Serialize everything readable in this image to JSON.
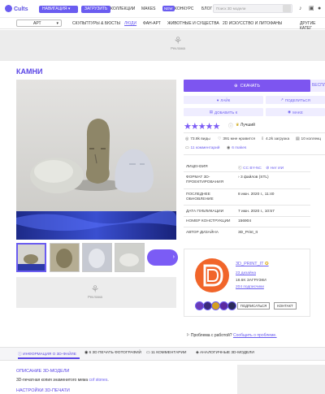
{
  "header": {
    "logo": "Cults",
    "nav_select": "НАВИГАЦИЯ",
    "upload": "ЗАГРУЗИТЬ",
    "links": [
      "КОЛЛЕКЦИИ",
      "MAKES"
    ],
    "new_badge": "NEW",
    "contest": "КОНКУРС",
    "blog": "БЛОГ",
    "search_placeholder": "Поиск 3D модели"
  },
  "subnav": {
    "category": "АРТ",
    "links": [
      "СКУЛЬПТУРЫ & БЮСТЫ",
      "ЛЮДИ",
      "ФАН-АРТ",
      "ЖИВОТНЫЕ И СУЩЕСТВА",
      "2D ИСКУССТВО И ЛИТОФАНЫ"
    ],
    "other": "ДРУГИЕ КАТЕГ"
  },
  "ad_label": "Реклама",
  "title": "КАМНИ",
  "actions": {
    "download": "СКАЧАТЬ",
    "free": "БЕСПЛ",
    "like": "ЛАЙК",
    "share": "ПОДЕЛИТЬСЯ",
    "add": "ДОБАВИТЬ К",
    "make": "MAKE"
  },
  "rating": {
    "stars": "★★★★★",
    "best": "Лучший"
  },
  "stats": {
    "views": "73.8k виды",
    "likes": "391 мне нравится",
    "downloads": "4.2k загрузка",
    "collections": "10 коллекц",
    "comments": "11 комментарий",
    "makes": "6 makes"
  },
  "meta": [
    {
      "label": "ЛИЦЕНЗИЯ",
      "value": "CC BY-NC"
    },
    {
      "label": "ФОРМАТ 3D-ПРОЕКТИРОВАНИЯ",
      "value": "3 файлов (STL)"
    },
    {
      "label": "ПОСЛЕДНЕЕ ОБНОВЛЕНИЕ",
      "value": "8 июн. 2020 г., 11:40"
    },
    {
      "label": "ДАТА ПУБЛИКАЦИИ",
      "value": "7 июн. 2020 г., 10:57"
    },
    {
      "label": "НОМЕР КОНСТРУКЦИИ",
      "value": "156904"
    },
    {
      "label": "АВТОР ДИЗАЙНА",
      "value": "3D_Print_It"
    }
  ],
  "license_extra": "Нет ИИ",
  "creator": {
    "name": "3D_PRINT_IT",
    "designs": "23 дизайна",
    "downloads": "18.6K ЗАГРУЗКИ",
    "followers": "204 подписчики",
    "subscribe": "ПОДПИСАТЬСЯ",
    "contact": "КОНТАКТ"
  },
  "problem": {
    "text": "Проблема с работой?",
    "link": "Сообщить о проблеме."
  },
  "tabs": [
    "ИНФОРМАЦИЯ О 3D-ФАЙЛЕ",
    "6 3D ПЕЧАТЬ ФОТОГРАФИЙ",
    "11 КОММЕНТАРИИ",
    "АНАЛОГИЧНЫЕ 3D-МОДЕЛИ"
  ],
  "description": {
    "title": "ОПИСАНИЕ 3D-МОДЕЛИ",
    "text": "3D-печатная копия знаменитого мема ",
    "link": "cof stones",
    "title2": "НАСТРОЙКИ 3D-ПЕЧАТИ"
  },
  "colors": {
    "accent": "#6a5cf0",
    "avatar": "#f1652a"
  }
}
